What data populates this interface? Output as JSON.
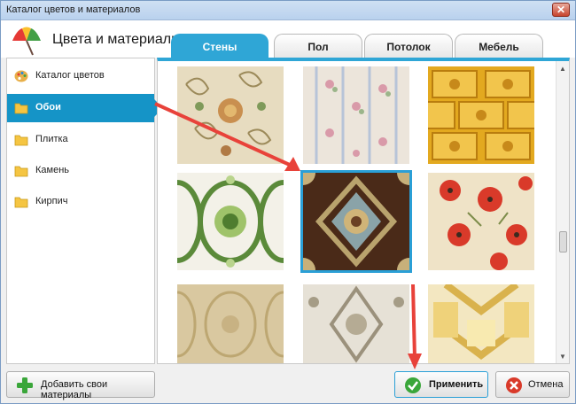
{
  "window": {
    "title": "Каталог цветов и материалов",
    "close_glyph": "✕"
  },
  "header": {
    "title": "Цвета и материалы"
  },
  "tabs": [
    {
      "label": "Стены",
      "active": true
    },
    {
      "label": "Пол",
      "active": false
    },
    {
      "label": "Потолок",
      "active": false
    },
    {
      "label": "Мебель",
      "active": false
    }
  ],
  "sidebar": {
    "items": [
      {
        "label": "Каталог цветов",
        "icon": "palette-icon",
        "active": false
      },
      {
        "label": "Обои",
        "icon": "folder-icon",
        "active": true
      },
      {
        "label": "Плитка",
        "icon": "folder-icon",
        "active": false
      },
      {
        "label": "Камень",
        "icon": "folder-icon",
        "active": false
      },
      {
        "label": "Кирпич",
        "icon": "folder-icon",
        "active": false
      }
    ]
  },
  "gallery": {
    "selected_index": 4,
    "items": [
      {
        "name": "beige-paisley-wallpaper"
      },
      {
        "name": "pastel-floral-stripes-wallpaper"
      },
      {
        "name": "golden-tile-wallpaper"
      },
      {
        "name": "green-ornament-wallpaper"
      },
      {
        "name": "brown-damask-wallpaper"
      },
      {
        "name": "red-poppies-wallpaper"
      },
      {
        "name": "beige-damask-wallpaper"
      },
      {
        "name": "grey-damask-wallpaper"
      },
      {
        "name": "yellow-geometric-wallpaper"
      }
    ]
  },
  "buttons": {
    "add_materials": "Добавить свои материалы",
    "apply": "Применить",
    "cancel": "Отмена"
  },
  "colors": {
    "accent": "#2fa6d6",
    "sidebar_active": "#1594c7",
    "arrow": "#e8423a"
  }
}
